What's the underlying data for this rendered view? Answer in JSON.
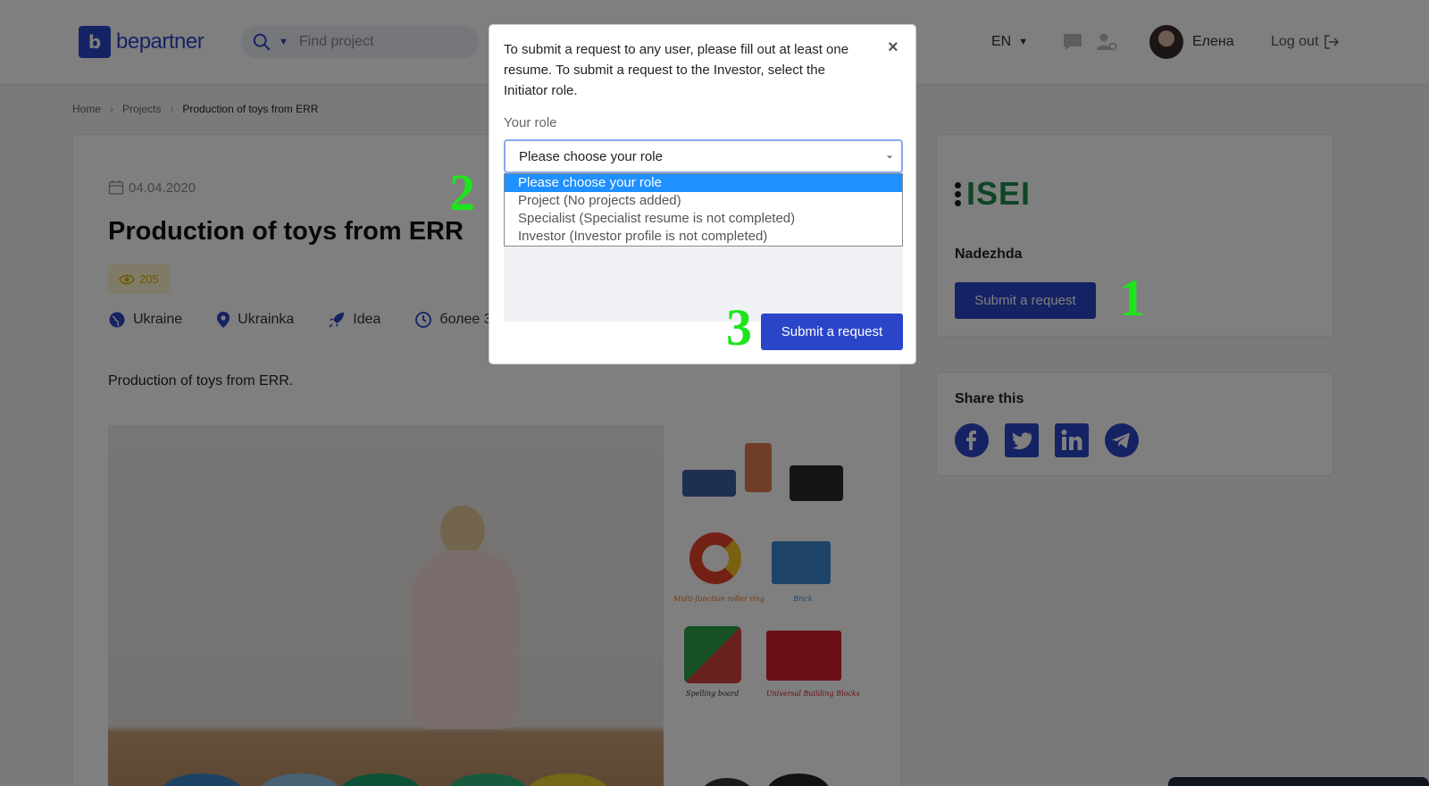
{
  "header": {
    "logo_text": "bepartner",
    "search_placeholder": "Find project",
    "language": "EN",
    "user_name": "Елена",
    "logout_label": "Log out"
  },
  "breadcrumb": {
    "items": [
      "Home",
      "Projects",
      "Production of toys from ERR"
    ]
  },
  "project": {
    "date": "04.04.2020",
    "title": "Production of toys from ERR",
    "views": "205",
    "country": "Ukraine",
    "city": "Ukrainka",
    "stage": "Idea",
    "term": "более 3",
    "description": "Production of toys from ERR.",
    "toy_captions": [
      "Multi-function roller ring",
      "Brick",
      "Spelling board",
      "Universal Building Blocks"
    ]
  },
  "sidebar": {
    "company_logo_text": "ISEI",
    "owner_name": "Nadezhda",
    "submit_label": "Submit a request",
    "share_title": "Share this",
    "social_icons": [
      "facebook-icon",
      "twitter-icon",
      "linkedin-icon",
      "telegram-icon"
    ]
  },
  "modal": {
    "message": "To submit a request to any user, please fill out at least one resume. To submit a request to the Investor, select the Initiator role.",
    "close_label": "×",
    "role_label": "Your role",
    "role_selected": "Please choose your role",
    "role_options": [
      "Please choose your role",
      "Project (No projects added)",
      "Specialist (Specialist resume is not completed)",
      "Investor (Investor profile is not completed)"
    ],
    "submit_label": "Submit a request"
  },
  "annotations": [
    "1",
    "2",
    "3"
  ],
  "colors": {
    "brand_blue": "#2b45c9",
    "highlight_blue": "#1e90ff",
    "annotation_green": "#1ee51e",
    "company_green": "#1f8a4c"
  }
}
